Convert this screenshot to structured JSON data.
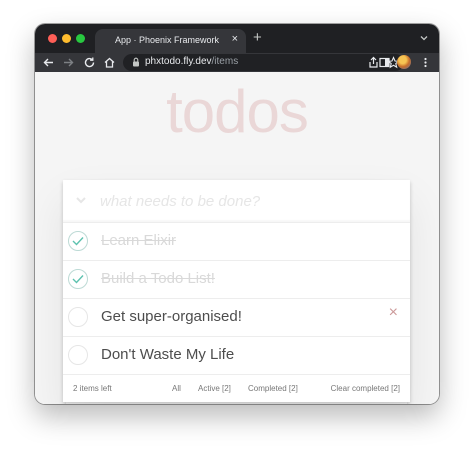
{
  "browser": {
    "tab_title": "App · Phoenix Framework",
    "tab_close": "×",
    "new_tab": "+",
    "url_host": "phxtodo.fly.dev",
    "url_path": "/items"
  },
  "app": {
    "title": "todos",
    "new_todo_placeholder": "what needs to be done?",
    "todos": [
      {
        "label": "Learn Elixir",
        "completed": true
      },
      {
        "label": "Build a Todo List!",
        "completed": true
      },
      {
        "label": "Get super-organised!",
        "completed": false,
        "show_delete": true
      },
      {
        "label": "Don't Waste My Life",
        "completed": false
      }
    ],
    "delete_icon": "×",
    "footer": {
      "items_left": "2 items left",
      "filter_all": "All",
      "filter_active": "Active [2]",
      "filter_completed": "Completed [2]",
      "clear_completed": "Clear completed [2]"
    }
  },
  "colors": {
    "title": "#f1dede",
    "check": "#5dc2af",
    "delete": "#cc9a9a"
  }
}
